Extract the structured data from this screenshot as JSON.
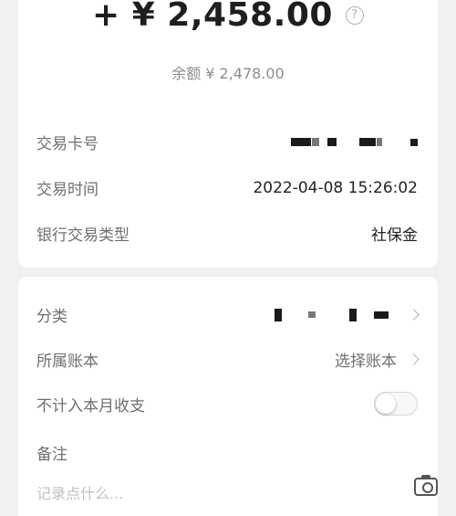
{
  "header": {
    "amount": "+ ¥ 2,458.00",
    "help_icon": "question-circle-icon",
    "balance": "余额 ¥ 2,478.00"
  },
  "details": {
    "card_label": "交易卡号",
    "time_label": "交易时间",
    "time_value": "2022-04-08 15:26:02",
    "type_label": "银行交易类型",
    "type_value": "社保金"
  },
  "settings": {
    "category_label": "分类",
    "account_label": "所属账本",
    "account_value": "选择账本",
    "exclude_label": "不计入本月收支",
    "exclude_enabled": false,
    "note_label": "备注",
    "note_placeholder": "记录点什么...",
    "camera_icon": "camera-icon",
    "chevron_icon": "chevron-right-icon"
  }
}
